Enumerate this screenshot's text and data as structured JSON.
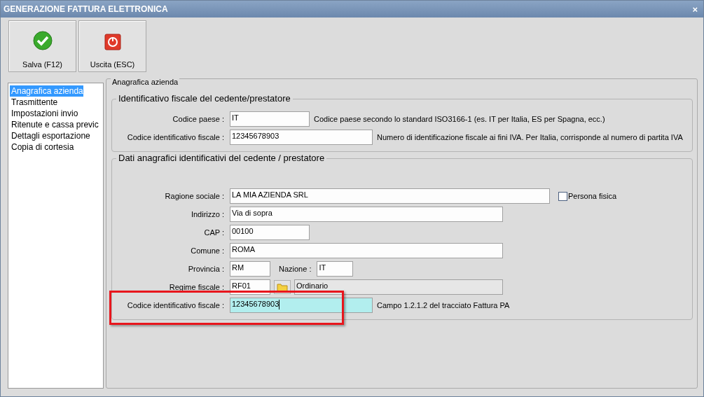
{
  "window": {
    "title": "GENERAZIONE FATTURA ELETTRONICA",
    "close": "×"
  },
  "toolbar": [
    {
      "kind": "save",
      "label": "Salva (F12)"
    },
    {
      "kind": "exit",
      "label": "Uscita (ESC)"
    }
  ],
  "sidebar": {
    "items": [
      {
        "label": "Anagrafica azienda",
        "selected": true
      },
      {
        "label": "Trasmittente",
        "selected": false
      },
      {
        "label": "Impostazioni invio",
        "selected": false
      },
      {
        "label": "Ritenute e cassa previc",
        "selected": false
      },
      {
        "label": "Dettagli esportazione",
        "selected": false
      },
      {
        "label": "Copia di cortesia",
        "selected": false
      }
    ]
  },
  "panel": {
    "title": "Anagrafica azienda",
    "groups": [
      {
        "title": "Identificativo fiscale del cedente/prestatore",
        "rows": [
          {
            "kind": "text",
            "label": "Codice paese :",
            "value": "IT",
            "hint": "Codice paese secondo lo standard ISO3166-1 (es. IT per Italia, ES per Spagna, ecc.)"
          },
          {
            "kind": "text",
            "label": "Codice identificativo fiscale :",
            "value": "12345678903",
            "hint": "Numero di identificazione fiscale ai fini IVA. Per Italia, corrisponde al numero di partita IVA"
          }
        ]
      },
      {
        "title": "Dati anagrafici identificativi del cedente / prestatore",
        "rows": [
          {
            "kind": "check",
            "label": "Ragione sociale :",
            "value": "LA MIA AZIENDA SRL",
            "check_label": "Persona fisica",
            "checked": false
          },
          {
            "kind": "text",
            "label": "Indirizzo :",
            "value": "Via di sopra"
          },
          {
            "kind": "text",
            "label": "CAP :",
            "value": "00100"
          },
          {
            "kind": "text",
            "label": "Comune :",
            "value": "ROMA"
          },
          {
            "kind": "pair",
            "label": "Provincia :",
            "value": "RM",
            "label2": "Nazione :",
            "value2": "IT"
          },
          {
            "kind": "lookup",
            "label": "Regime fiscale :",
            "value": "RF01",
            "description": "Ordinario"
          },
          {
            "kind": "text",
            "label": "Codice identificativo fiscale :",
            "value": "12345678903",
            "focused": true,
            "annotated": true,
            "hint": "Campo 1.2.1.2 del tracciato Fattura PA"
          }
        ]
      }
    ]
  }
}
